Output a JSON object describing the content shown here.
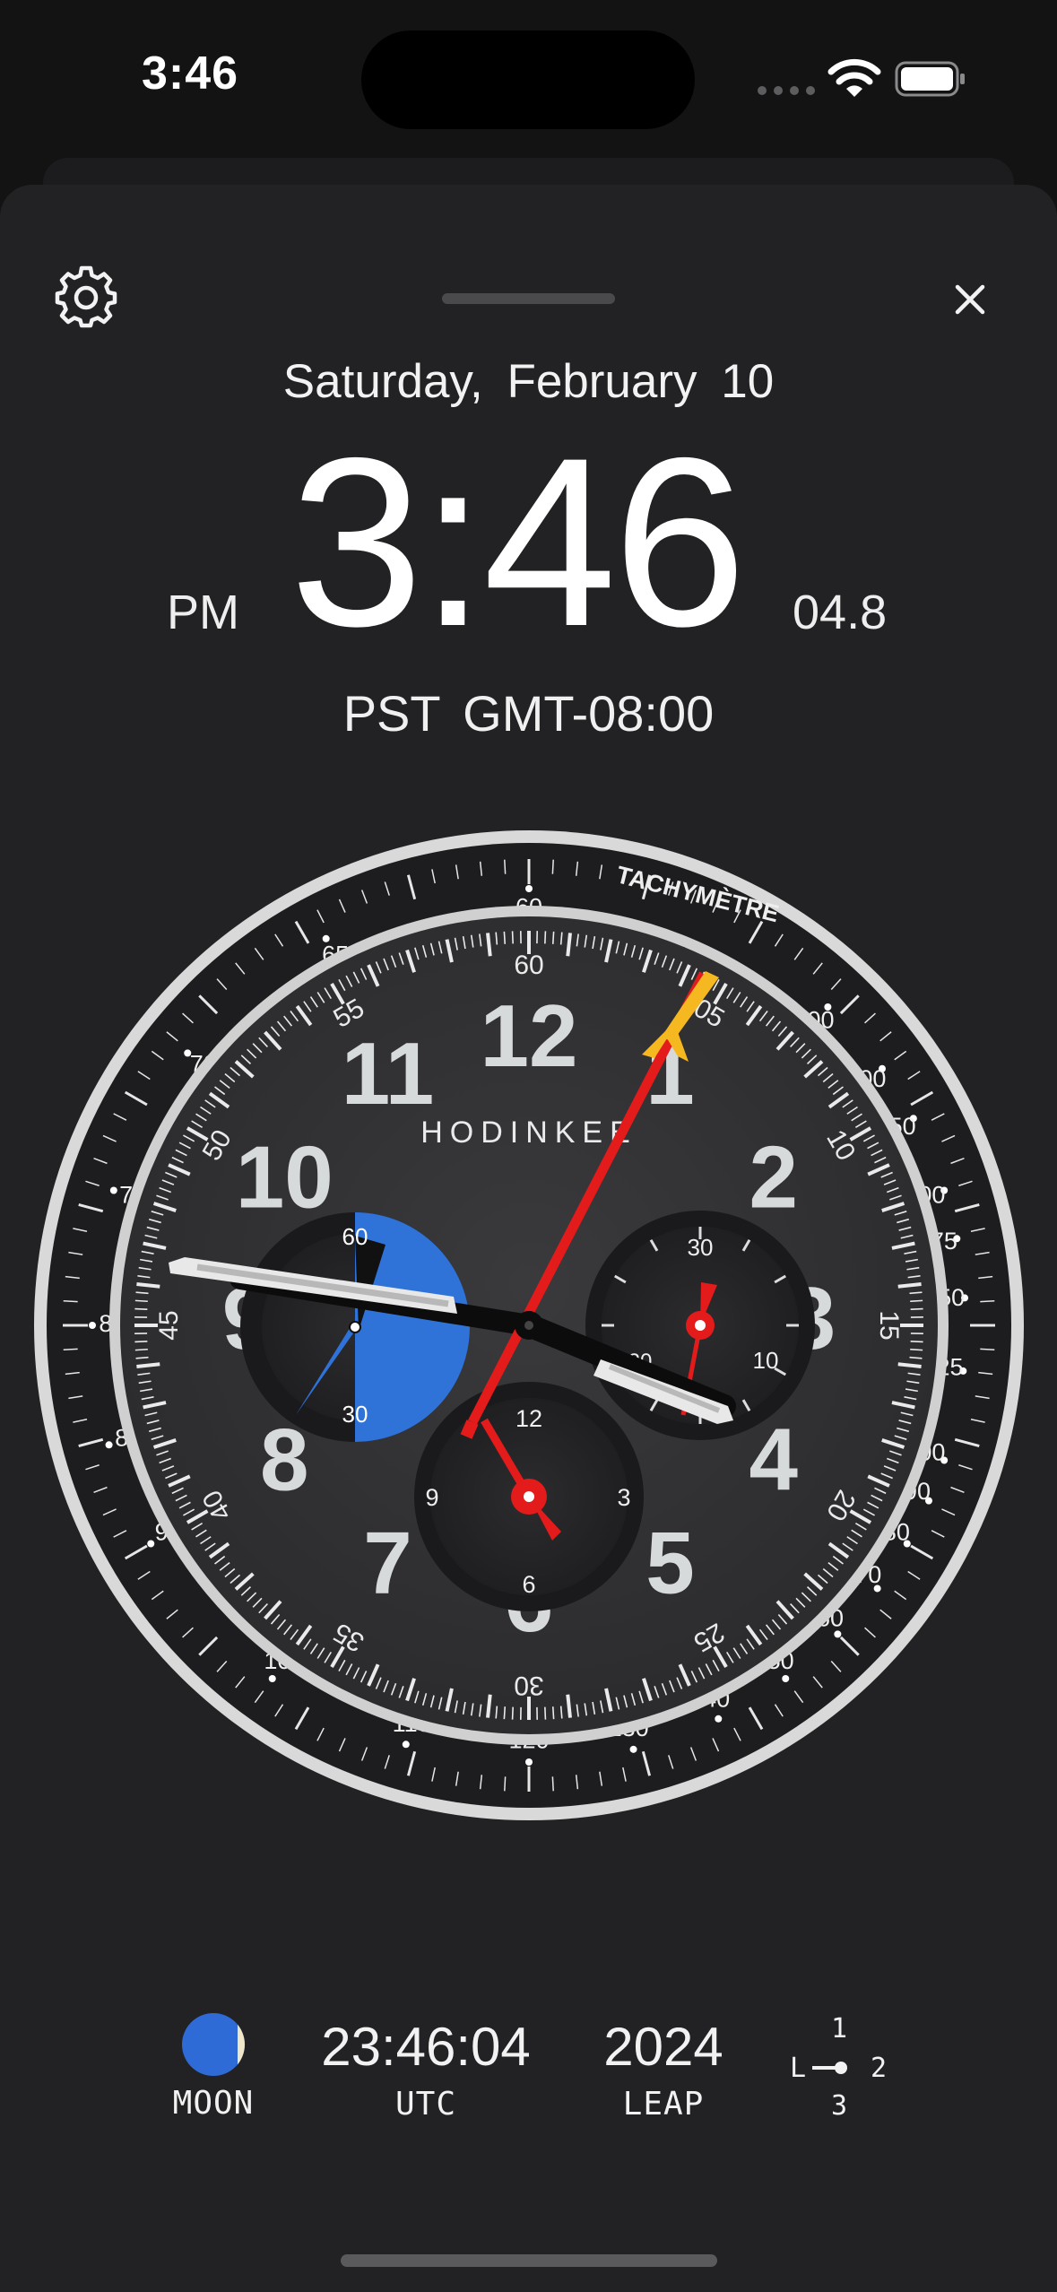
{
  "status_bar": {
    "time": "3:46"
  },
  "header": {
    "date": "Saturday,  February  10",
    "time": "3:46",
    "ampm": "PM",
    "seconds": "04.8",
    "timezone": "PST  GMT-08:00"
  },
  "dial": {
    "brand": "HODINKEE",
    "bezel_label": "TACHYMÈTRE",
    "hour_numerals": [
      "12",
      "1",
      "2",
      "3",
      "4",
      "5",
      "6",
      "7",
      "8",
      "9",
      "10",
      "11"
    ],
    "minute_ring_labels": [
      "60",
      "05",
      "10",
      "15",
      "20",
      "25",
      "30",
      "35",
      "40",
      "45",
      "50",
      "55"
    ],
    "tachy_labels": [
      "60",
      "65",
      "70",
      "75",
      "80",
      "85",
      "90",
      "100",
      "110",
      "120",
      "130",
      "140",
      "150",
      "160",
      "170",
      "180",
      "190",
      "200",
      "225",
      "250",
      "275",
      "300",
      "350",
      "400",
      "500"
    ],
    "left_subdial_labels": [
      "60",
      "30"
    ],
    "right_subdial_labels": [
      "30",
      "20",
      "10"
    ],
    "bottom_subdial_labels": [
      "12",
      "3",
      "6",
      "9"
    ],
    "colors": {
      "seconds_hand": "#e41b1b",
      "accent_blue": "#2f73d9",
      "tip_yellow": "#f6b820"
    }
  },
  "footer": {
    "moon_label": "MOON",
    "utc_value": "23:46:04",
    "utc_label": "UTC",
    "year_value": "2024",
    "year_label": "LEAP",
    "gear_top": "1",
    "gear_left": "L",
    "gear_right": "2",
    "gear_bottom": "3"
  }
}
